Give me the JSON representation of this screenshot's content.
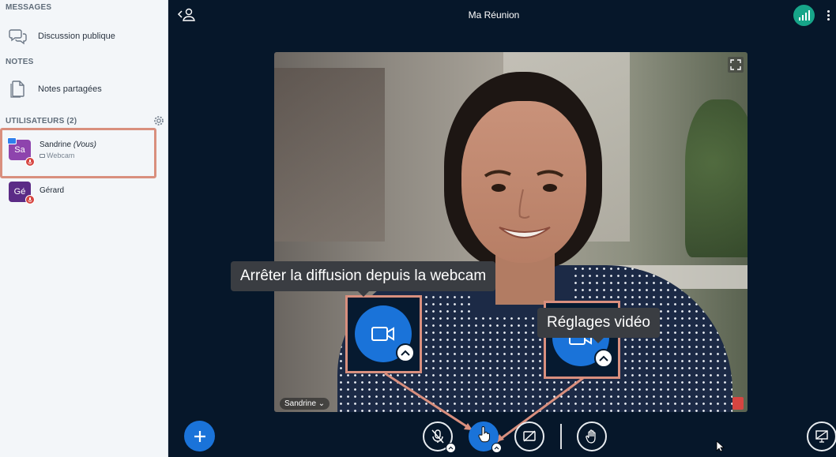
{
  "sidebar": {
    "messages_title": "MESSAGES",
    "public_chat_label": "Discussion publique",
    "notes_title": "NOTES",
    "shared_notes_label": "Notes partagées",
    "users_title": "UTILISATEURS (2)",
    "users": [
      {
        "initials": "Sa",
        "name": "Sandrine",
        "you_tag": "(Vous)",
        "status": "Webcam"
      },
      {
        "initials": "Gé",
        "name": "Gérard"
      }
    ]
  },
  "header": {
    "title": "Ma Réunion"
  },
  "video": {
    "name_tag": "Sandrine"
  },
  "tooltips": {
    "webcam": "Arrêter la diffusion depuis la webcam",
    "video_settings": "Réglages vidéo"
  },
  "colors": {
    "accent": "#1a73d9",
    "highlight": "#d98f7e",
    "mute": "#d64541",
    "connection": "#17a589",
    "background": "#06172a"
  },
  "icons": [
    "chat-icon",
    "notes-icon",
    "gear-icon",
    "user-back-icon",
    "signal-icon",
    "more-icon",
    "fullscreen-icon",
    "plus-icon",
    "mic-off-icon",
    "camera-icon",
    "screen-share-off-icon",
    "raise-hand-icon",
    "presentation-icon"
  ]
}
